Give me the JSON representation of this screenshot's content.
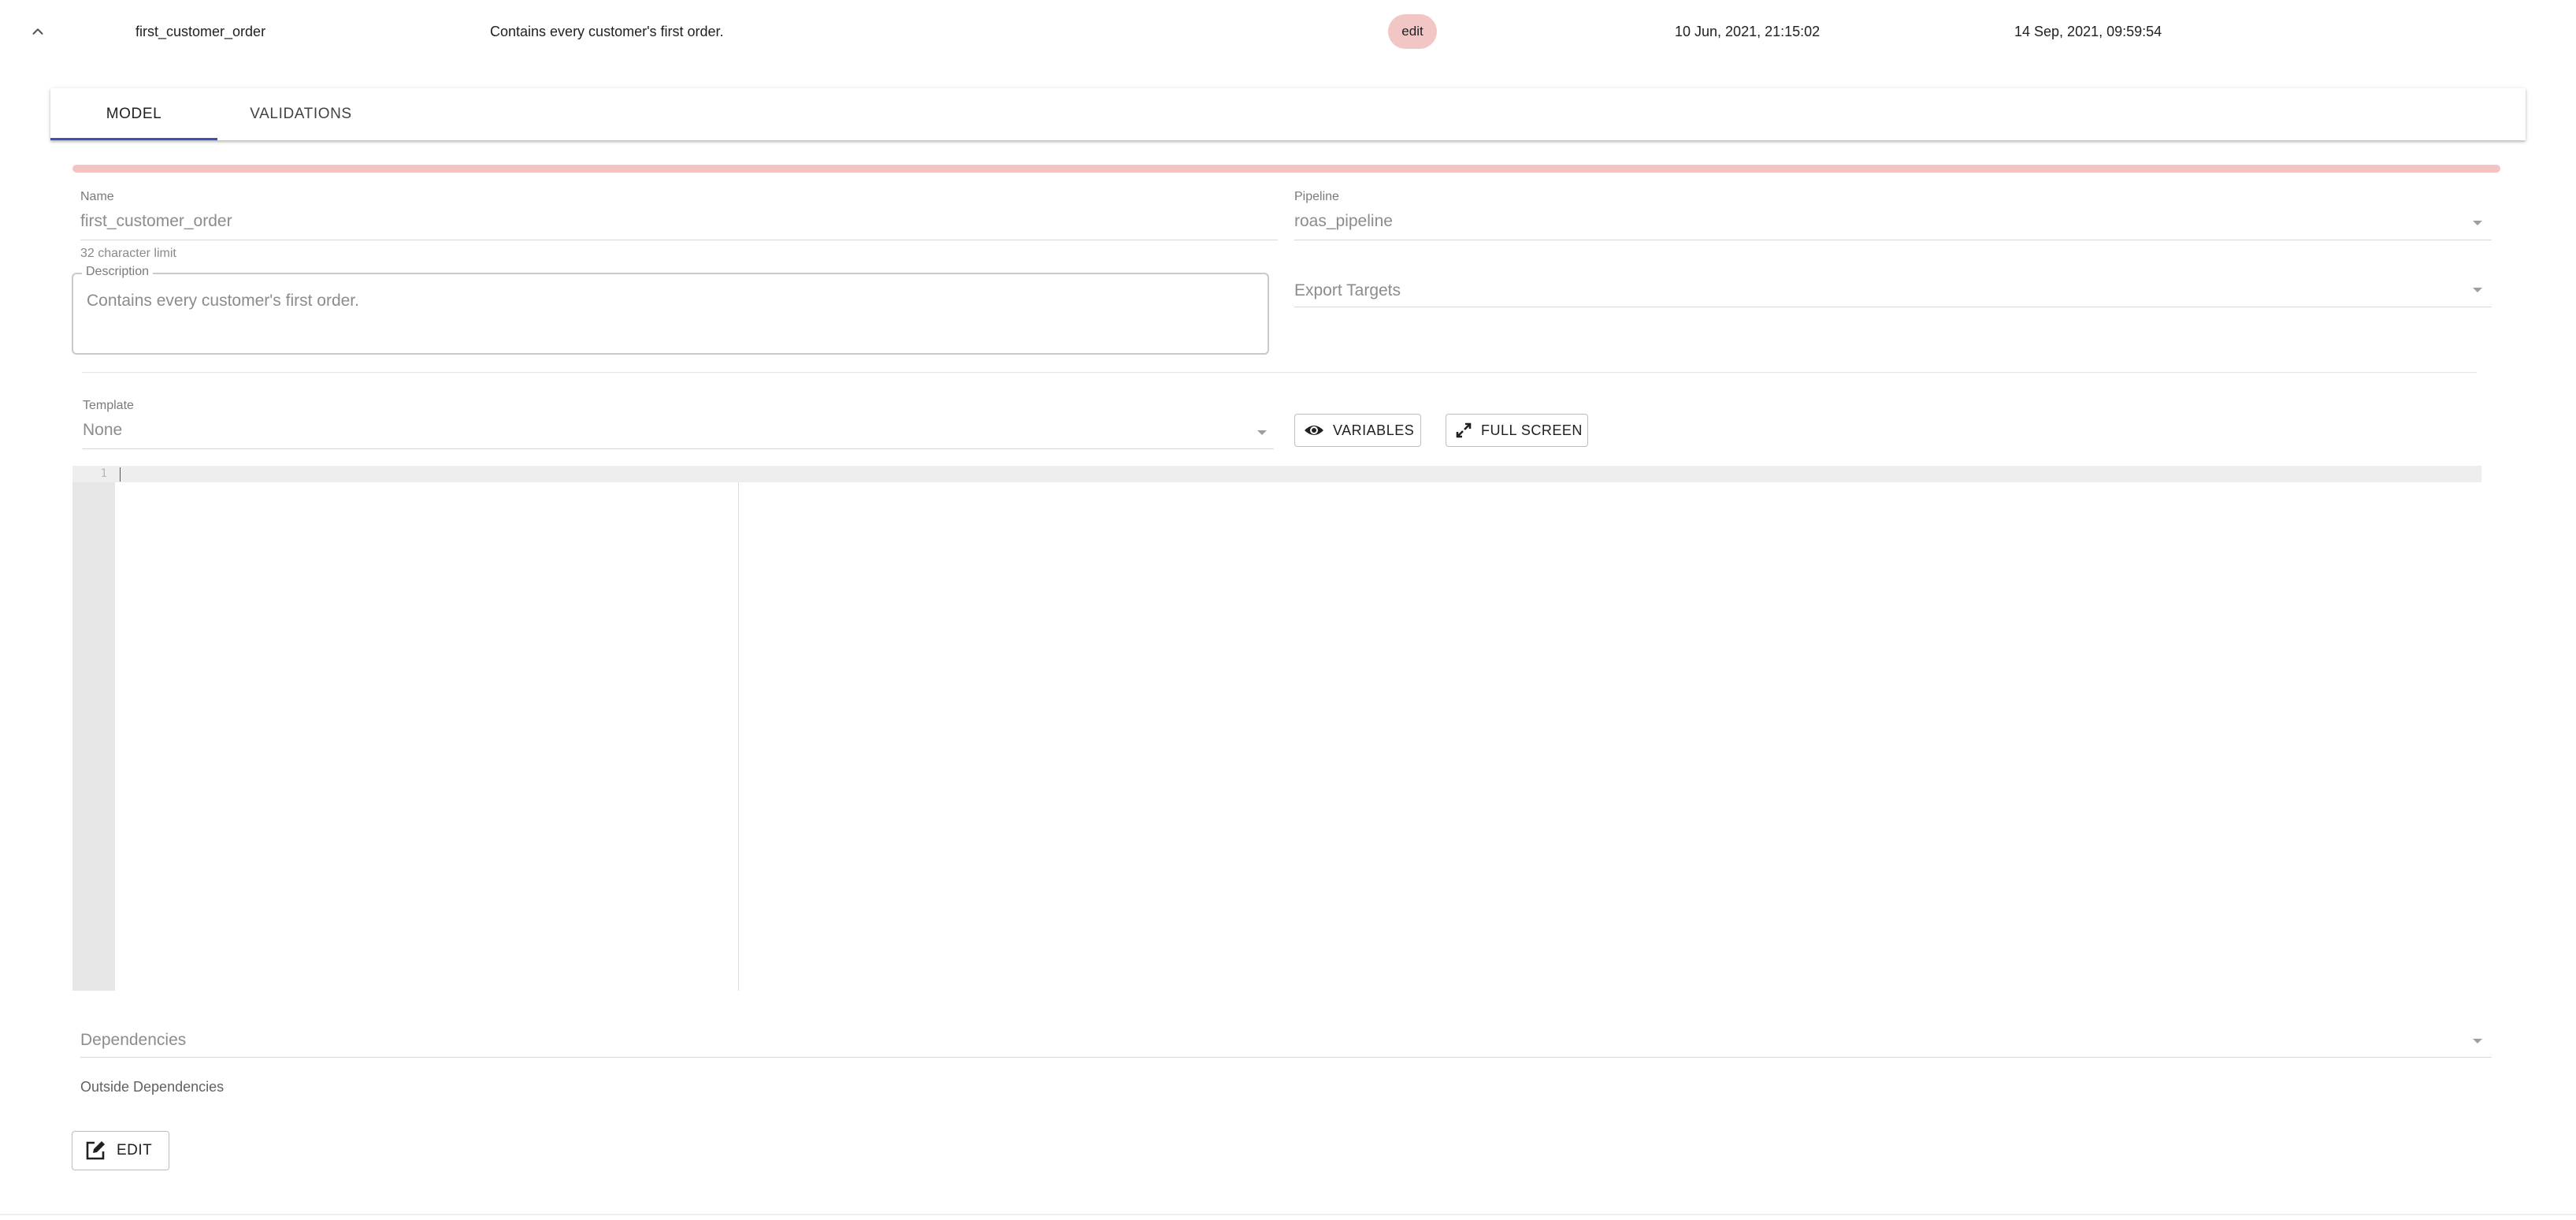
{
  "row": {
    "name": "first_customer_order",
    "description": "Contains every customer's first order.",
    "status_badge": "edit",
    "created": "10 Jun, 2021, 21:15:02",
    "updated": "14 Sep, 2021, 09:59:54",
    "collapse_icon": "chevron-up-icon"
  },
  "tabs": [
    {
      "label": "MODEL",
      "active": true
    },
    {
      "label": "VALIDATIONS",
      "active": false
    }
  ],
  "colors": {
    "error_bar": "#f4c4c4",
    "badge": "#f3c6c6",
    "tab_indicator": "#3f51b5"
  },
  "form": {
    "name": {
      "label": "Name",
      "value": "first_customer_order",
      "helper": "32 character limit"
    },
    "pipeline": {
      "label": "Pipeline",
      "value": "roas_pipeline"
    },
    "description": {
      "label": "Description",
      "value": "Contains every customer's first order."
    },
    "export_targets": {
      "placeholder": "Export Targets"
    },
    "template": {
      "label": "Template",
      "value": "None"
    }
  },
  "buttons": {
    "variables": {
      "label": "VARIABLES",
      "icon": "eye-icon"
    },
    "full_screen": {
      "label": "FULL SCREEN",
      "icon": "expand-icon"
    },
    "edit": {
      "label": "EDIT",
      "icon": "edit-icon"
    }
  },
  "editor": {
    "line_numbers": [
      "1"
    ],
    "content": ""
  },
  "dependencies": {
    "placeholder": "Dependencies",
    "outside_label": "Outside Dependencies"
  }
}
